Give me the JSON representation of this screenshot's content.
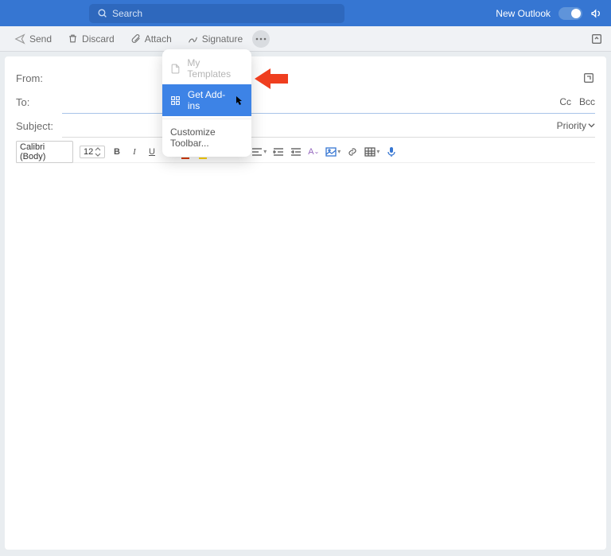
{
  "header": {
    "search_placeholder": "Search",
    "new_outlook_label": "New Outlook"
  },
  "toolbar": {
    "send_label": "Send",
    "discard_label": "Discard",
    "attach_label": "Attach",
    "signature_label": "Signature"
  },
  "dropdown": {
    "my_templates": "My Templates",
    "get_addins": "Get Add-ins",
    "customize": "Customize Toolbar..."
  },
  "compose": {
    "from_label": "From:",
    "to_label": "To:",
    "subject_label": "Subject:",
    "cc_label": "Cc",
    "bcc_label": "Bcc",
    "priority_label": "Priority"
  },
  "format": {
    "font_name": "Calibri (Body)",
    "font_size": "12"
  }
}
